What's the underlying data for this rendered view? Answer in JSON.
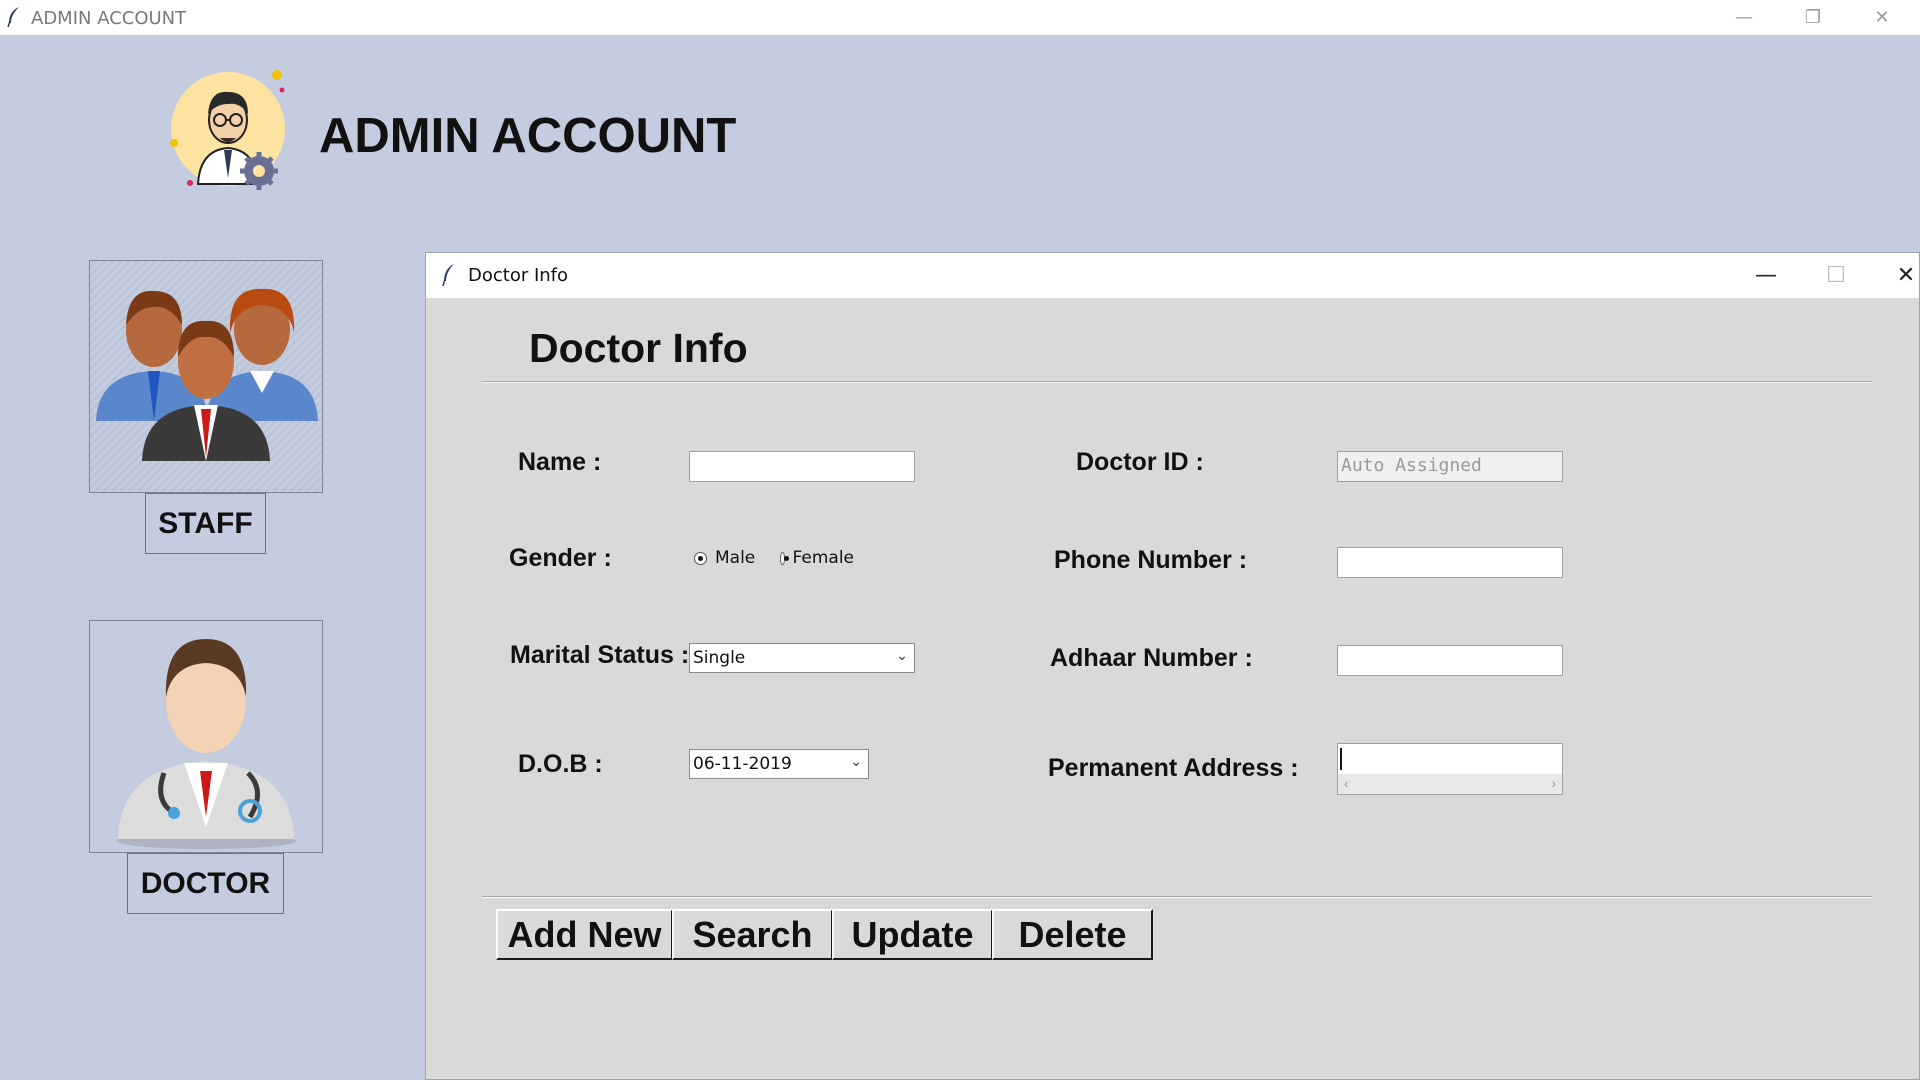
{
  "window": {
    "title": "ADMIN ACCOUNT",
    "minimize": "—",
    "restore": "❐",
    "close": "✕"
  },
  "header": {
    "title": "ADMIN ACCOUNT",
    "avatar_icon": "admin-avatar-icon"
  },
  "sidebar": {
    "staff": {
      "label": "STAFF",
      "icon": "staff-group-icon"
    },
    "doctor": {
      "label": "DOCTOR",
      "icon": "doctor-icon"
    }
  },
  "dialog": {
    "title": "Doctor Info",
    "heading": "Doctor Info",
    "controls": {
      "minimize": "—",
      "maximize": "☐",
      "close": "✕"
    },
    "form": {
      "name": {
        "label": "Name :",
        "value": ""
      },
      "gender": {
        "label": "Gender :",
        "options": [
          "Male",
          "Female"
        ],
        "selected": "Male"
      },
      "marital_status": {
        "label": "Marital Status :",
        "value": "Single"
      },
      "dob": {
        "label": "D.O.B :",
        "value": "06-11-2019"
      },
      "doctor_id": {
        "label": "Doctor ID :",
        "value": "Auto Assigned"
      },
      "phone": {
        "label": "Phone Number :",
        "value": ""
      },
      "adhaar": {
        "label": "Adhaar Number :",
        "value": ""
      },
      "address": {
        "label": "Permanent Address :",
        "value": ""
      }
    },
    "buttons": {
      "add_new": "Add New",
      "search": "Search",
      "update": "Update",
      "delete": "Delete"
    }
  }
}
